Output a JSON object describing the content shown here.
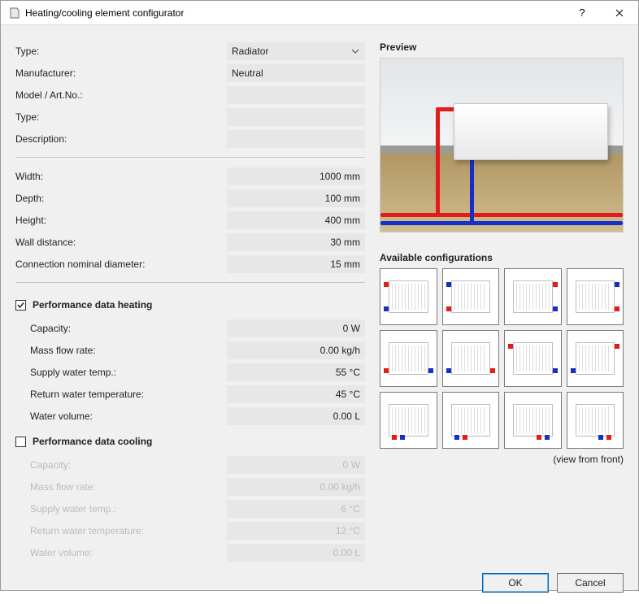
{
  "window": {
    "title": "Heating/cooling element configurator"
  },
  "form": {
    "type1_label": "Type:",
    "type1_value": "Radiator",
    "manufacturer_label": "Manufacturer:",
    "manufacturer_value": "Neutral",
    "model_label": "Model / Art.No.:",
    "model_value": "",
    "type2_label": "Type:",
    "type2_value": "",
    "description_label": "Description:",
    "description_value": ""
  },
  "dims": {
    "width_label": "Width:",
    "width_value": "1000 mm",
    "depth_label": "Depth:",
    "depth_value": "100 mm",
    "height_label": "Height:",
    "height_value": "400 mm",
    "wall_label": "Wall distance:",
    "wall_value": "30 mm",
    "conn_label": "Connection nominal diameter:",
    "conn_value": "15 mm"
  },
  "heating": {
    "title": "Performance data heating",
    "capacity_label": "Capacity:",
    "capacity_value": "0 W",
    "mass_label": "Mass flow rate:",
    "mass_value": "0.00 kg/h",
    "supply_label": "Supply water temp.:",
    "supply_value": "55 °C",
    "return_label": "Return water temperature:",
    "return_value": "45 °C",
    "volume_label": "Water volume:",
    "volume_value": "0.00 L"
  },
  "cooling": {
    "title": "Performance data cooling",
    "capacity_label": "Capacity:",
    "capacity_value": "0 W",
    "mass_label": "Mass flow rate:",
    "mass_value": "0.00 kg/h",
    "supply_label": "Supply water temp.:",
    "supply_value": "6 °C",
    "return_label": "Return water temperature:",
    "return_value": "12 °C",
    "volume_label": "Water volume:",
    "volume_value": "0.00 L"
  },
  "right": {
    "preview_title": "Preview",
    "available_title": "Available configurations",
    "view_note": "(view from front)"
  },
  "footer": {
    "ok": "OK",
    "cancel": "Cancel"
  }
}
